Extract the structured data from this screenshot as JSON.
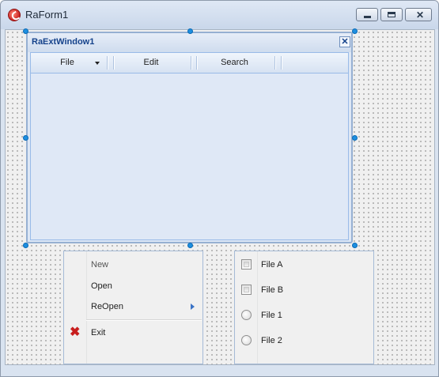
{
  "form": {
    "title": "RaForm1",
    "icon": "app-logo-icon",
    "controls": {
      "minimize": "minimize-icon",
      "maximize": "maximize-icon",
      "close": "close-icon"
    }
  },
  "ext_window": {
    "title": "RaExtWindow1",
    "close_glyph": "✕",
    "toolbar": [
      "File",
      "Edit",
      "Search"
    ]
  },
  "menu": {
    "items": [
      {
        "label": "New"
      },
      {
        "label": "Open"
      },
      {
        "label": "ReOpen",
        "has_submenu": true
      },
      {
        "label": "Exit",
        "icon": "exit-x-icon",
        "icon_color": "#c81e1e"
      }
    ]
  },
  "options": {
    "items": [
      {
        "label": "File A",
        "type": "checkbox",
        "checked": false
      },
      {
        "label": "File B",
        "type": "checkbox",
        "checked": false
      },
      {
        "label": "File 1",
        "type": "radio",
        "checked": false
      },
      {
        "label": "File 2",
        "type": "radio",
        "checked": false
      }
    ]
  },
  "colors": {
    "accent": "#15428b",
    "selection_handle": "#1e8fe0",
    "panel_border": "#a5bad6"
  }
}
